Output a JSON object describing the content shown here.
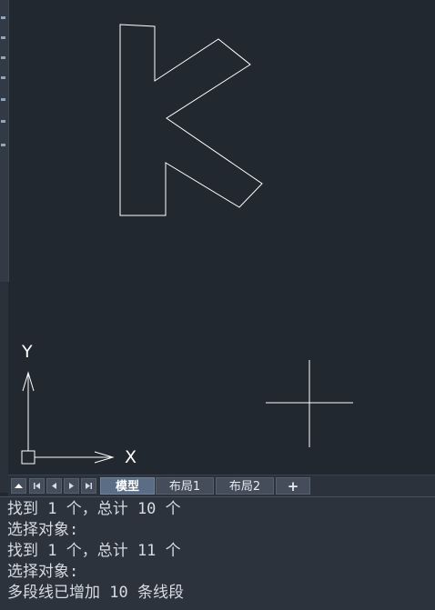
{
  "colors": {
    "canvas_bg": "#212830",
    "geometry_stroke": "#ffffff",
    "tab_active": "#5a6d84"
  },
  "ucs": {
    "x_label": "X",
    "y_label": "Y"
  },
  "tabs": {
    "model": "模型",
    "layout1": "布局1",
    "layout2": "布局2",
    "add": "+"
  },
  "nav_icons": [
    "tab-bar-toggle-icon",
    "first-tab-icon",
    "prev-tab-icon",
    "next-tab-icon",
    "last-tab-icon"
  ],
  "command_history": [
    "找到 1 个，总计 10 个",
    "选择对象:",
    "找到 1 个，总计 11 个",
    "选择对象:",
    "多段线已增加 10 条线段"
  ]
}
